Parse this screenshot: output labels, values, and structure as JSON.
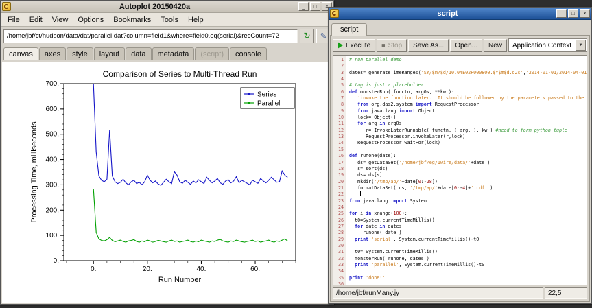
{
  "icons": {
    "minimize": "_",
    "maximize": "□",
    "close": "×",
    "reload": "↻",
    "inspect": "✎",
    "combo_arrow": "▼",
    "stop": "■"
  },
  "main_window": {
    "title": "Autoplot 20150420a",
    "menu": [
      "File",
      "Edit",
      "View",
      "Options",
      "Bookmarks",
      "Tools",
      "Help"
    ],
    "address": "/home/jbf/ct/hudson/data/dat/parallel.dat?column=field1&where=field0.eq(serial)&recCount=72",
    "tabs": [
      {
        "label": "canvas",
        "state": "active"
      },
      {
        "label": "axes",
        "state": "normal"
      },
      {
        "label": "style",
        "state": "normal"
      },
      {
        "label": "layout",
        "state": "normal"
      },
      {
        "label": "data",
        "state": "normal"
      },
      {
        "label": "metadata",
        "state": "normal"
      },
      {
        "label": "(script)",
        "state": "disabled"
      },
      {
        "label": "console",
        "state": "normal"
      }
    ]
  },
  "chart_data": {
    "type": "line",
    "title": "Comparison of Series to Multi-Thread Run",
    "xlabel": "Run Number",
    "ylabel": "Processing Time, milliseconds",
    "xlim": [
      -11,
      75
    ],
    "ylim": [
      0,
      700
    ],
    "x_ticks": [
      0,
      20,
      40,
      60
    ],
    "x_tick_labels": [
      "0.",
      "20.",
      "40.",
      "60."
    ],
    "y_ticks": [
      0,
      100,
      200,
      300,
      400,
      500,
      600,
      700
    ],
    "y_tick_labels": [
      "0.",
      "100.",
      "200.",
      "300.",
      "400.",
      "500.",
      "600.",
      "700."
    ],
    "x_minor": 5,
    "y_minor": 20,
    "grid": false,
    "legend_position": "top-right",
    "x_start": 0,
    "x_step": 1,
    "series": [
      {
        "name": "Series",
        "color": "#1414c8",
        "values": [
          700,
          430,
          335,
          318,
          312,
          322,
          518,
          335,
          312,
          305,
          310,
          322,
          308,
          300,
          312,
          318,
          305,
          310,
          300,
          312,
          338,
          318,
          308,
          315,
          303,
          298,
          310,
          322,
          312,
          305,
          352,
          338,
          312,
          306,
          318,
          310,
          302,
          315,
          308,
          320,
          312,
          305,
          330,
          318,
          308,
          315,
          325,
          308,
          302,
          315,
          320,
          308,
          315,
          332,
          308,
          318,
          312,
          306,
          300,
          318,
          312,
          306,
          325,
          315,
          308,
          318,
          330,
          320,
          310,
          312,
          355,
          338,
          330
        ]
      },
      {
        "name": "Parallel",
        "color": "#00a000",
        "values": [
          285,
          112,
          86,
          80,
          78,
          83,
          92,
          80,
          75,
          78,
          81,
          76,
          73,
          78,
          80,
          83,
          76,
          73,
          78,
          75,
          81,
          78,
          73,
          76,
          80,
          78,
          75,
          73,
          78,
          81,
          76,
          78,
          73,
          76,
          78,
          81,
          76,
          73,
          78,
          75,
          81,
          78,
          76,
          73,
          78,
          76,
          81,
          84,
          78,
          75,
          73,
          78,
          76,
          81,
          78,
          75,
          73,
          76,
          78,
          81,
          76,
          78,
          73,
          76,
          78,
          81,
          76,
          73,
          78,
          76,
          81,
          86,
          78
        ]
      }
    ]
  },
  "script_window": {
    "title": "script",
    "tab_label": "script",
    "toolbar": {
      "execute": "Execute",
      "stop": "Stop",
      "save_as": "Save As...",
      "open": "Open...",
      "new": "New",
      "context": "Application Context"
    },
    "status_file": "/home/jbf/runMany.jy",
    "status_pos": "22,5",
    "caret_line": 22,
    "code_lines": [
      [
        [
          "c",
          "# run parallel demo"
        ]
      ],
      [],
      [
        [
          "p",
          "dates= generateTimeRanges("
        ],
        [
          "s",
          "'$Y/$m/$d/10.04E02F000800.$Y$m$d.d2s'"
        ],
        [
          "p",
          ","
        ],
        [
          "s",
          "'2014-01-01/2014-04-01'"
        ],
        [
          "p",
          ")"
        ]
      ],
      [],
      [
        [
          "c",
          "# tag is just a placeholder."
        ]
      ],
      [
        [
          "k",
          "def"
        ],
        [
          "p",
          " monsterRun( functn, arg0s, **kw ):"
        ]
      ],
      [
        [
          "p",
          "   "
        ],
        [
          "s",
          "'invoke the function later.  It should be followed by the parameters passed to the function'"
        ]
      ],
      [
        [
          "p",
          "   "
        ],
        [
          "k",
          "from"
        ],
        [
          "p",
          " org.das2.system "
        ],
        [
          "k",
          "import"
        ],
        [
          "p",
          " RequestProcessor"
        ]
      ],
      [
        [
          "p",
          "   "
        ],
        [
          "k",
          "from"
        ],
        [
          "p",
          " java.lang "
        ],
        [
          "k",
          "import"
        ],
        [
          "p",
          " Object"
        ]
      ],
      [
        [
          "p",
          "   lock= Object()"
        ]
      ],
      [
        [
          "p",
          "   "
        ],
        [
          "k",
          "for"
        ],
        [
          "p",
          " arg "
        ],
        [
          "k",
          "in"
        ],
        [
          "p",
          " arg0s:"
        ]
      ],
      [
        [
          "p",
          "      r= InvokeLaterRunnable( functn, ( arg, ), kw ) "
        ],
        [
          "c",
          "#need to form python tuple"
        ]
      ],
      [
        [
          "p",
          "      RequestProcessor.invokeLater(r,lock)"
        ]
      ],
      [
        [
          "p",
          "   RequestProcessor.waitFor(lock)"
        ]
      ],
      [],
      [
        [
          "k",
          "def"
        ],
        [
          "p",
          " runone(date):"
        ]
      ],
      [
        [
          "p",
          "   ds= getDataSet("
        ],
        [
          "s",
          "'/home/jbf/eg/1wire/data/'"
        ],
        [
          "p",
          "+date )"
        ]
      ],
      [
        [
          "p",
          "   s= sort(ds)"
        ]
      ],
      [
        [
          "p",
          "   ds= ds[s]"
        ]
      ],
      [
        [
          "p",
          "   mkdir("
        ],
        [
          "s",
          "'/tmp/ap/'"
        ],
        [
          "p",
          "+date["
        ],
        [
          "n",
          "0"
        ],
        [
          "p",
          ":-"
        ],
        [
          "n",
          "28"
        ],
        [
          "p",
          "])"
        ]
      ],
      [
        [
          "p",
          "   formatDataSet( ds, "
        ],
        [
          "s",
          "'/tmp/ap/'"
        ],
        [
          "p",
          "+date["
        ],
        [
          "n",
          "0"
        ],
        [
          "p",
          ":-"
        ],
        [
          "n",
          "4"
        ],
        [
          "p",
          "]+"
        ],
        [
          "s",
          "'.cdf'"
        ],
        [
          "p",
          " )"
        ]
      ],
      [
        [
          "p",
          "    "
        ]
      ],
      [
        [
          "k",
          "from"
        ],
        [
          "p",
          " java.lang "
        ],
        [
          "k",
          "import"
        ],
        [
          "p",
          " System"
        ]
      ],
      [],
      [
        [
          "k",
          "for"
        ],
        [
          "p",
          " i "
        ],
        [
          "k",
          "in"
        ],
        [
          "p",
          " xrange("
        ],
        [
          "n",
          "100"
        ],
        [
          "p",
          "):"
        ]
      ],
      [
        [
          "p",
          "  t0=System.currentTimeMillis()"
        ]
      ],
      [
        [
          "p",
          "  "
        ],
        [
          "k",
          "for"
        ],
        [
          "p",
          " date "
        ],
        [
          "k",
          "in"
        ],
        [
          "p",
          " dates:"
        ]
      ],
      [
        [
          "p",
          "     runone( date )"
        ]
      ],
      [
        [
          "p",
          "  "
        ],
        [
          "k",
          "print"
        ],
        [
          "p",
          " "
        ],
        [
          "s",
          "'serial'"
        ],
        [
          "p",
          ", System.currentTimeMillis()-t0"
        ]
      ],
      [],
      [
        [
          "p",
          "  t0= System.currentTimeMillis()"
        ]
      ],
      [
        [
          "p",
          "  monsterRun( runone, dates )"
        ]
      ],
      [
        [
          "p",
          "  "
        ],
        [
          "k",
          "print"
        ],
        [
          "p",
          " "
        ],
        [
          "s",
          "'parallel'"
        ],
        [
          "p",
          ", System.currentTimeMillis()-t0"
        ]
      ],
      [],
      [
        [
          "k",
          "print"
        ],
        [
          "p",
          " "
        ],
        [
          "s",
          "'done!'"
        ]
      ],
      []
    ]
  }
}
